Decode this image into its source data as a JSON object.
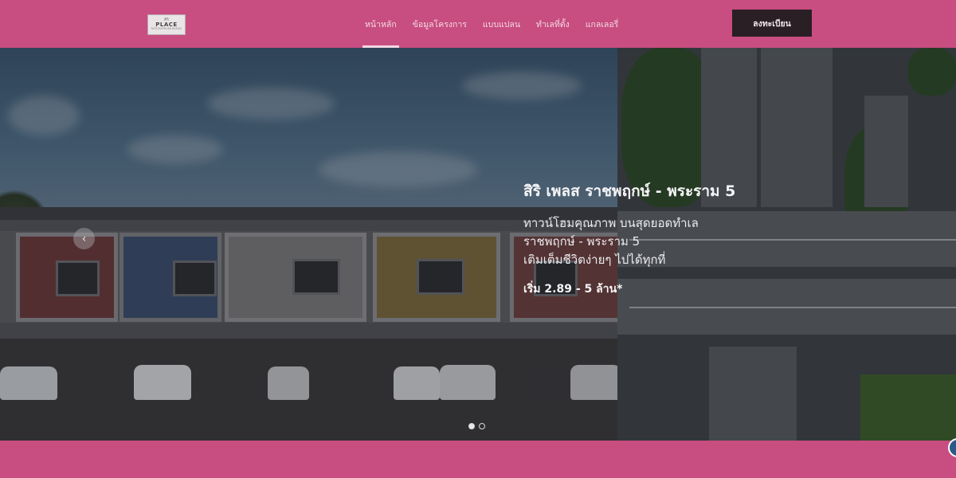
{
  "logo": {
    "line1": "ศิริ",
    "line2": "PLACE",
    "line3": "RATCHAPRUEK-RAMA5"
  },
  "nav": {
    "items": [
      {
        "label": "หน้าหลัก",
        "active": true
      },
      {
        "label": "ข้อมูลโครงการ",
        "active": false
      },
      {
        "label": "แบบแปลน",
        "active": false
      },
      {
        "label": "ทำเลที่ตั้ง",
        "active": false
      },
      {
        "label": "แกลเลอรี่",
        "active": false
      }
    ],
    "register_label": "ลงทะเบียน"
  },
  "hero": {
    "title": "สิริ เพลส ราชพฤกษ์ - พระราม 5",
    "desc_line1": "ทาวน์โฮมคุณภาพ บนสุดยอดทำเล",
    "desc_line2": "ราชพฤกษ์ - พระราม 5",
    "desc_line3": "เติมเต็มชีวิตง่ายๆ ไปได้ทุกที่",
    "price": "เริ่ม 2.89 - 5 ล้าน*",
    "prev_icon": "‹",
    "slide_count": 2,
    "active_slide": 1
  },
  "colors": {
    "header_bg": "#c84d80",
    "register_bg": "#2a1f24",
    "chat_button": "#2b5a88"
  },
  "icons": {
    "arrow": "chevron-left-icon",
    "chat": "chat-icon"
  }
}
